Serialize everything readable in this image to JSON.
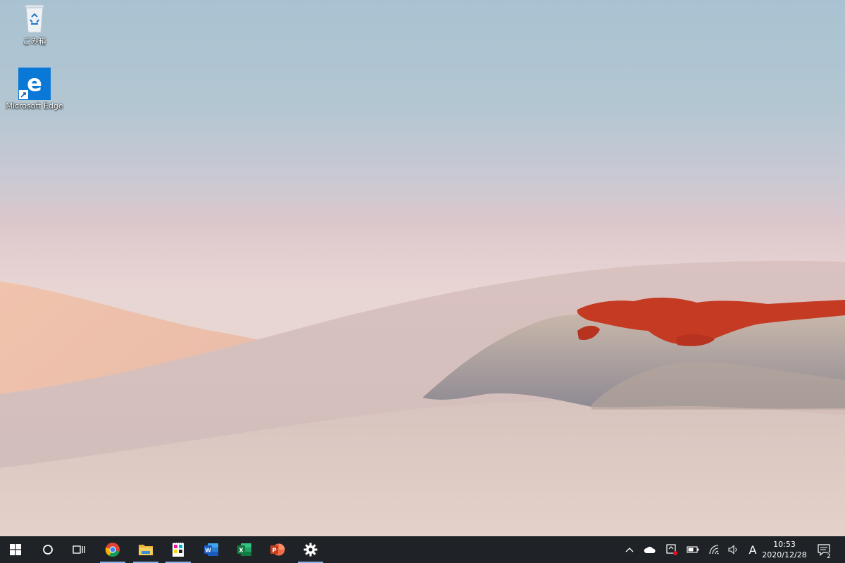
{
  "desktop": {
    "icons": [
      {
        "label": "ごみ箱",
        "icon": "recycle-bin-icon"
      },
      {
        "label": "Microsoft Edge",
        "icon": "edge-icon"
      }
    ]
  },
  "taskbar": {
    "buttons": [
      {
        "icon": "windows-start-icon",
        "running": false
      },
      {
        "icon": "cortana-search-icon",
        "running": false
      },
      {
        "icon": "task-view-icon",
        "running": false
      },
      {
        "icon": "chrome-icon",
        "running": true
      },
      {
        "icon": "file-explorer-icon",
        "running": true
      },
      {
        "icon": "paint-app-icon",
        "running": true
      },
      {
        "icon": "word-icon",
        "running": false
      },
      {
        "icon": "excel-icon",
        "running": false
      },
      {
        "icon": "powerpoint-icon",
        "running": false
      },
      {
        "icon": "settings-gear-icon",
        "running": true
      }
    ],
    "tray": {
      "icons": [
        "show-hidden-icons-chevron",
        "onedrive-cloud-icon",
        "screen-recorder-icon",
        "battery-icon",
        "wifi-icon",
        "volume-icon"
      ],
      "ime_indicator": "A",
      "clock_time": "10:53",
      "clock_date": "2020/12/28",
      "notification_count": "2"
    }
  },
  "colors": {
    "taskbar_bg": "#1f2327",
    "running_indicator": "#8ab4e8",
    "edge_blue": "#0a78d7",
    "red_grass": "#c53a22"
  }
}
